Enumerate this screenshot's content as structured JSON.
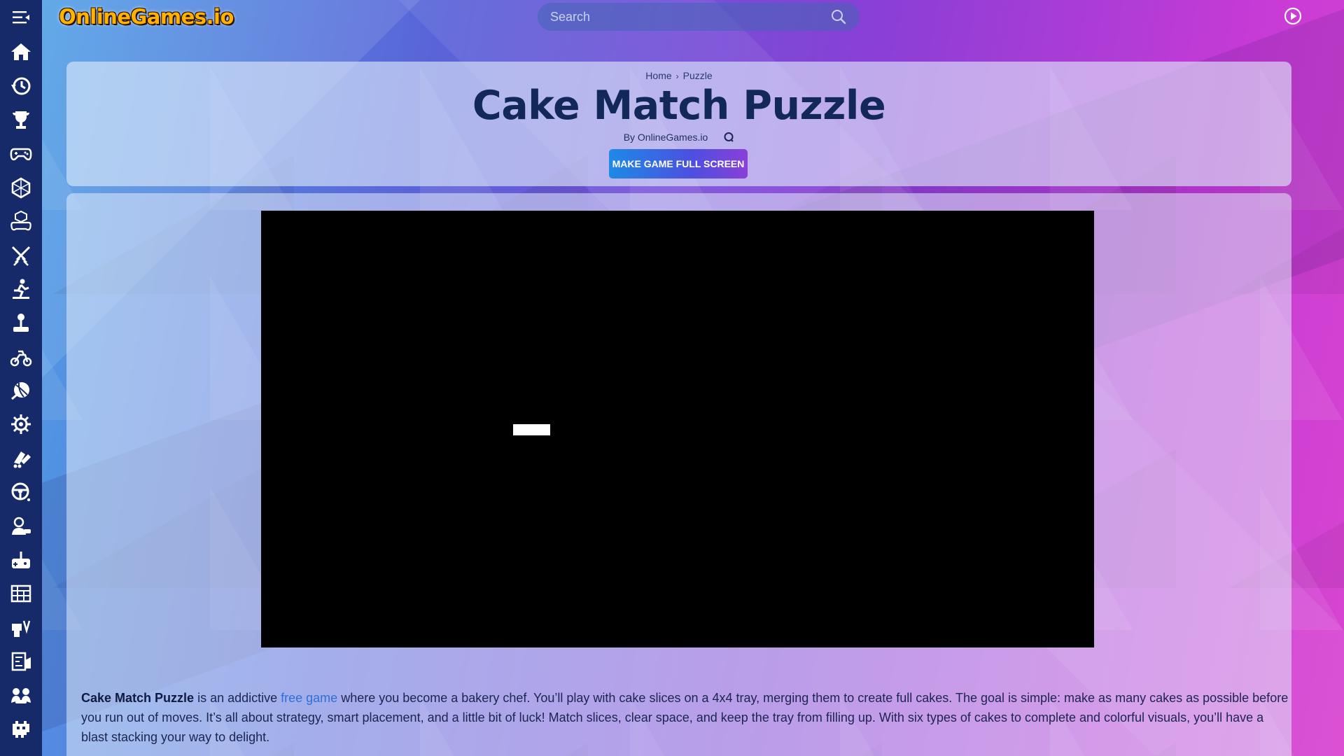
{
  "header": {
    "logo_text": "OnlineGames.io",
    "search_placeholder": "Search"
  },
  "sidebar": {
    "items": [
      {
        "icon": "home-icon"
      },
      {
        "icon": "history-icon"
      },
      {
        "icon": "trophy-icon"
      },
      {
        "icon": "gamepad-icon"
      },
      {
        "icon": "dice-icon"
      },
      {
        "icon": "controller-cube-icon"
      },
      {
        "icon": "crossed-swords-icon"
      },
      {
        "icon": "runner-icon"
      },
      {
        "icon": "joystick-icon"
      },
      {
        "icon": "motorbike-icon"
      },
      {
        "icon": "ball-icon"
      },
      {
        "icon": "gear-icon"
      },
      {
        "icon": "skates-icon"
      },
      {
        "icon": "steering-wheel-icon"
      },
      {
        "icon": "person-game-icon"
      },
      {
        "icon": "retro-gamepad-icon"
      },
      {
        "icon": "building-blocks-icon"
      },
      {
        "icon": "tools-icon"
      },
      {
        "icon": "puzzle-board-icon"
      },
      {
        "icon": "two-players-icon"
      },
      {
        "icon": "space-invader-icon"
      }
    ]
  },
  "breadcrumb": {
    "home": "Home",
    "separator": "›",
    "category": "Puzzle"
  },
  "game": {
    "title": "Cake Match Puzzle",
    "byline": "By OnlineGames.io",
    "fullscreen_label": "MAKE GAME FULL SCREEN"
  },
  "description": {
    "game_name": "Cake Match Puzzle",
    "text_1": " is an addictive ",
    "link_text": "free game",
    "text_2": " where you become a bakery chef. You’ll play with cake slices on a 4x4 tray, merging them to create full cakes. The goal is simple: make as many cakes as possible before you run out of moves. It’s all about strategy, smart placement, and a little bit of luck! Match slices, clear space, and keep the tray from filling up. With six types of cakes to complete and colorful visuals, you’ll have a blast stacking your way to delight."
  },
  "colors": {
    "sidebar_bg": "#162a6a",
    "title_color": "#13285a",
    "link_color": "#2f6fd6"
  }
}
